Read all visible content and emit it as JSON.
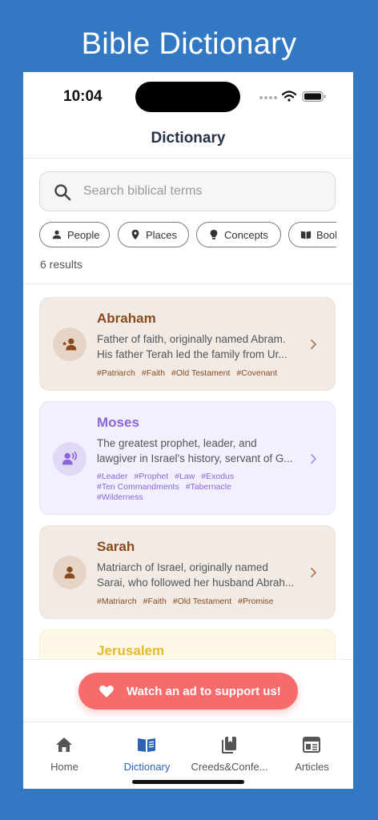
{
  "promo": {
    "title": "Bible Dictionary"
  },
  "status_bar": {
    "time": "10:04"
  },
  "header": {
    "title": "Dictionary"
  },
  "search": {
    "placeholder": "Search biblical terms",
    "value": ""
  },
  "filters": [
    {
      "label": "People",
      "icon": "person-icon"
    },
    {
      "label": "Places",
      "icon": "location-pin-icon"
    },
    {
      "label": "Concepts",
      "icon": "lightbulb-icon"
    },
    {
      "label": "Books",
      "icon": "book-icon"
    }
  ],
  "results": {
    "count_text": "6 results",
    "items": [
      {
        "title": "Abraham",
        "desc_line1": "Father of faith, originally named Abram.",
        "desc_line2": "His father Terah led the family from Ur...",
        "tags": [
          "#Patriarch",
          "#Faith",
          "#Old Testament",
          "#Covenant"
        ],
        "icon": "patriarch-person-icon",
        "color": "#8a4a1e"
      },
      {
        "title": "Moses",
        "desc_line1": "The greatest prophet, leader, and",
        "desc_line2": "lawgiver in Israel's history, servant of G...",
        "tags": [
          "#Leader",
          "#Prophet",
          "#Law",
          "#Exodus",
          "#Ten Commandments",
          "#Tabernacle",
          "#Wilderness"
        ],
        "icon": "speaking-person-icon",
        "color": "#8a67d8"
      },
      {
        "title": "Sarah",
        "desc_line1": "Matriarch of Israel, originally named",
        "desc_line2": "Sarai, who followed her husband Abrah...",
        "tags": [
          "#Matriarch",
          "#Faith",
          "#Old Testament",
          "#Promise"
        ],
        "icon": "person-icon",
        "color": "#8a4a1e"
      },
      {
        "title": "Jerusalem",
        "color": "#e5b92a"
      }
    ]
  },
  "ad": {
    "label": "Watch an ad to support us!",
    "color": "#f66b6b"
  },
  "tabs": [
    {
      "label": "Home",
      "icon": "home-icon"
    },
    {
      "label": "Dictionary",
      "icon": "open-book-icon",
      "active": true
    },
    {
      "label": "Creeds&Confe...",
      "icon": "books-icon"
    },
    {
      "label": "Articles",
      "icon": "newspaper-icon"
    }
  ],
  "colors": {
    "accent": "#2b63b5",
    "background": "#3278c3"
  }
}
